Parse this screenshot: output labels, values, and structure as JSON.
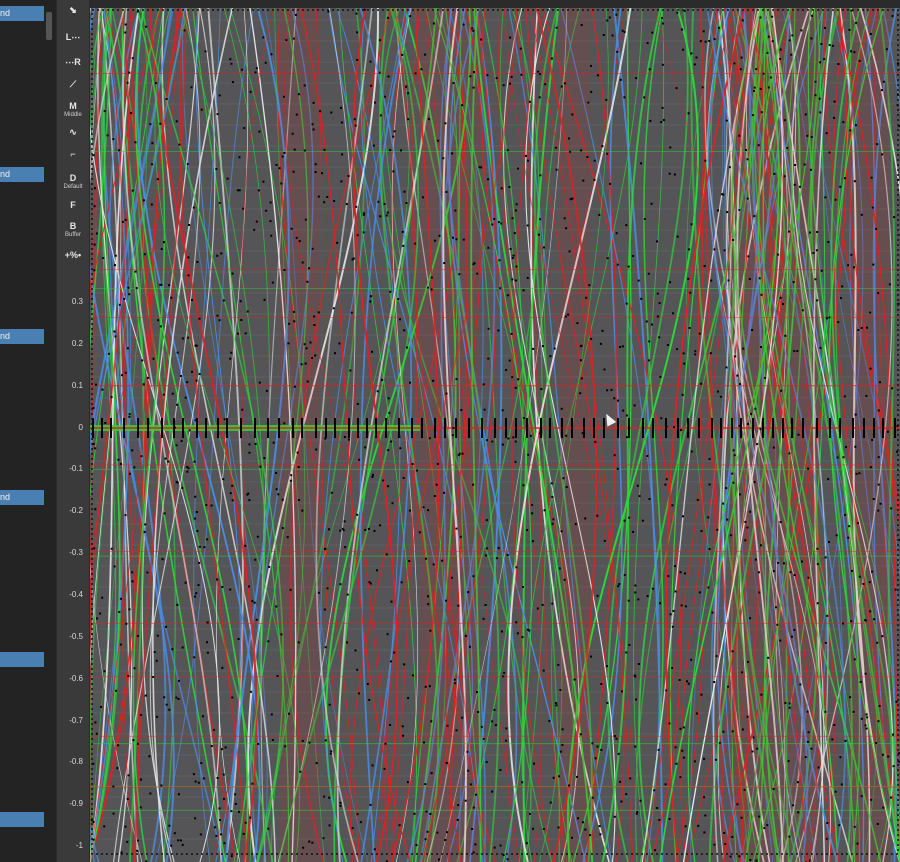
{
  "left_panel": {
    "tags": [
      "nd",
      "nd",
      "nd",
      "nd",
      "",
      ""
    ]
  },
  "toolbar": {
    "tools": [
      {
        "name": "select-icon",
        "glyph": "⬊",
        "label": "",
        "sub": ""
      },
      {
        "name": "linear-left-tool",
        "glyph": "L⋯",
        "label": "",
        "sub": ""
      },
      {
        "name": "linear-right-tool",
        "glyph": "⋯R",
        "label": "",
        "sub": ""
      },
      {
        "name": "middle-line-tool",
        "glyph": "⟋",
        "label": "",
        "sub": ""
      },
      {
        "name": "middle-tool",
        "glyph": "M",
        "label": "",
        "sub": "Middle"
      },
      {
        "name": "wave-tool",
        "glyph": "∿",
        "label": "",
        "sub": ""
      },
      {
        "name": "step-tool",
        "glyph": "⌐",
        "label": "",
        "sub": ""
      },
      {
        "name": "default-tool",
        "glyph": "D",
        "label": "",
        "sub": "Default"
      },
      {
        "name": "free-tool",
        "glyph": "F",
        "label": "",
        "sub": ""
      },
      {
        "name": "buffer-tool",
        "glyph": "B",
        "label": "",
        "sub": "Buffer"
      },
      {
        "name": "percent-tool",
        "glyph": "+%•",
        "label": "",
        "sub": ""
      }
    ]
  },
  "ruler": {
    "ticks": [
      "0.3",
      "0.2",
      "0.1",
      "0",
      "-0.1",
      "-0.2",
      "-0.3",
      "-0.4",
      "-0.5",
      "-0.6",
      "-0.7",
      "-0.8",
      "-0.9",
      "-1"
    ]
  },
  "colors": {
    "panel_bg": "#232323",
    "tag_bg": "#4a7fb4",
    "toolbar_bg": "#3a3a3a",
    "graph_bg": "#555557",
    "curve_red": "#e02020",
    "curve_green": "#2ed63a",
    "curve_blue": "#4a8ee8",
    "curve_white": "#e8e8e8",
    "key_dots": "#000000"
  }
}
